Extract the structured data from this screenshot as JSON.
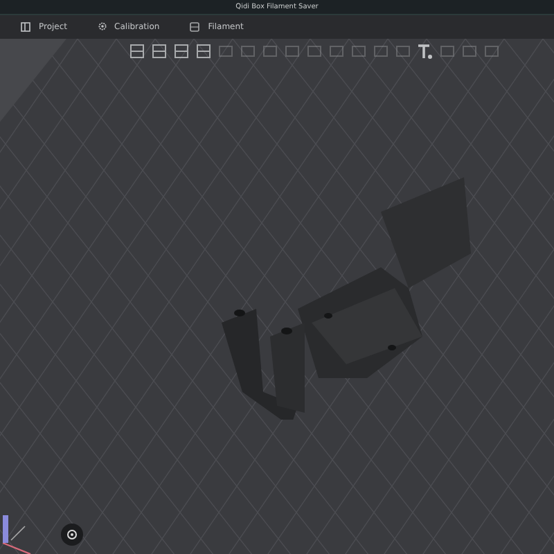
{
  "window": {
    "title": "Qidi Box Filament Saver"
  },
  "tabs": [
    {
      "label": "Project",
      "selected": false
    },
    {
      "label": "Calibration",
      "selected": false
    },
    {
      "label": "Filament",
      "selected": false
    }
  ]
}
